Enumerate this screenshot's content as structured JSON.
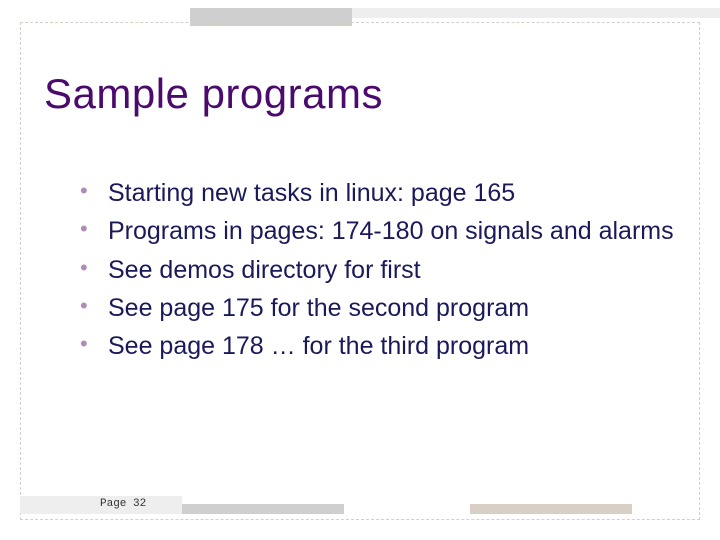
{
  "title": "Sample programs",
  "bullets": [
    "Starting new tasks in linux: page 165",
    "Programs in pages: 174-180 on signals and alarms",
    "See demos directory for first",
    "See page 175 for the second program",
    "See page 178 … for the third program"
  ],
  "page_label": "Page 32"
}
